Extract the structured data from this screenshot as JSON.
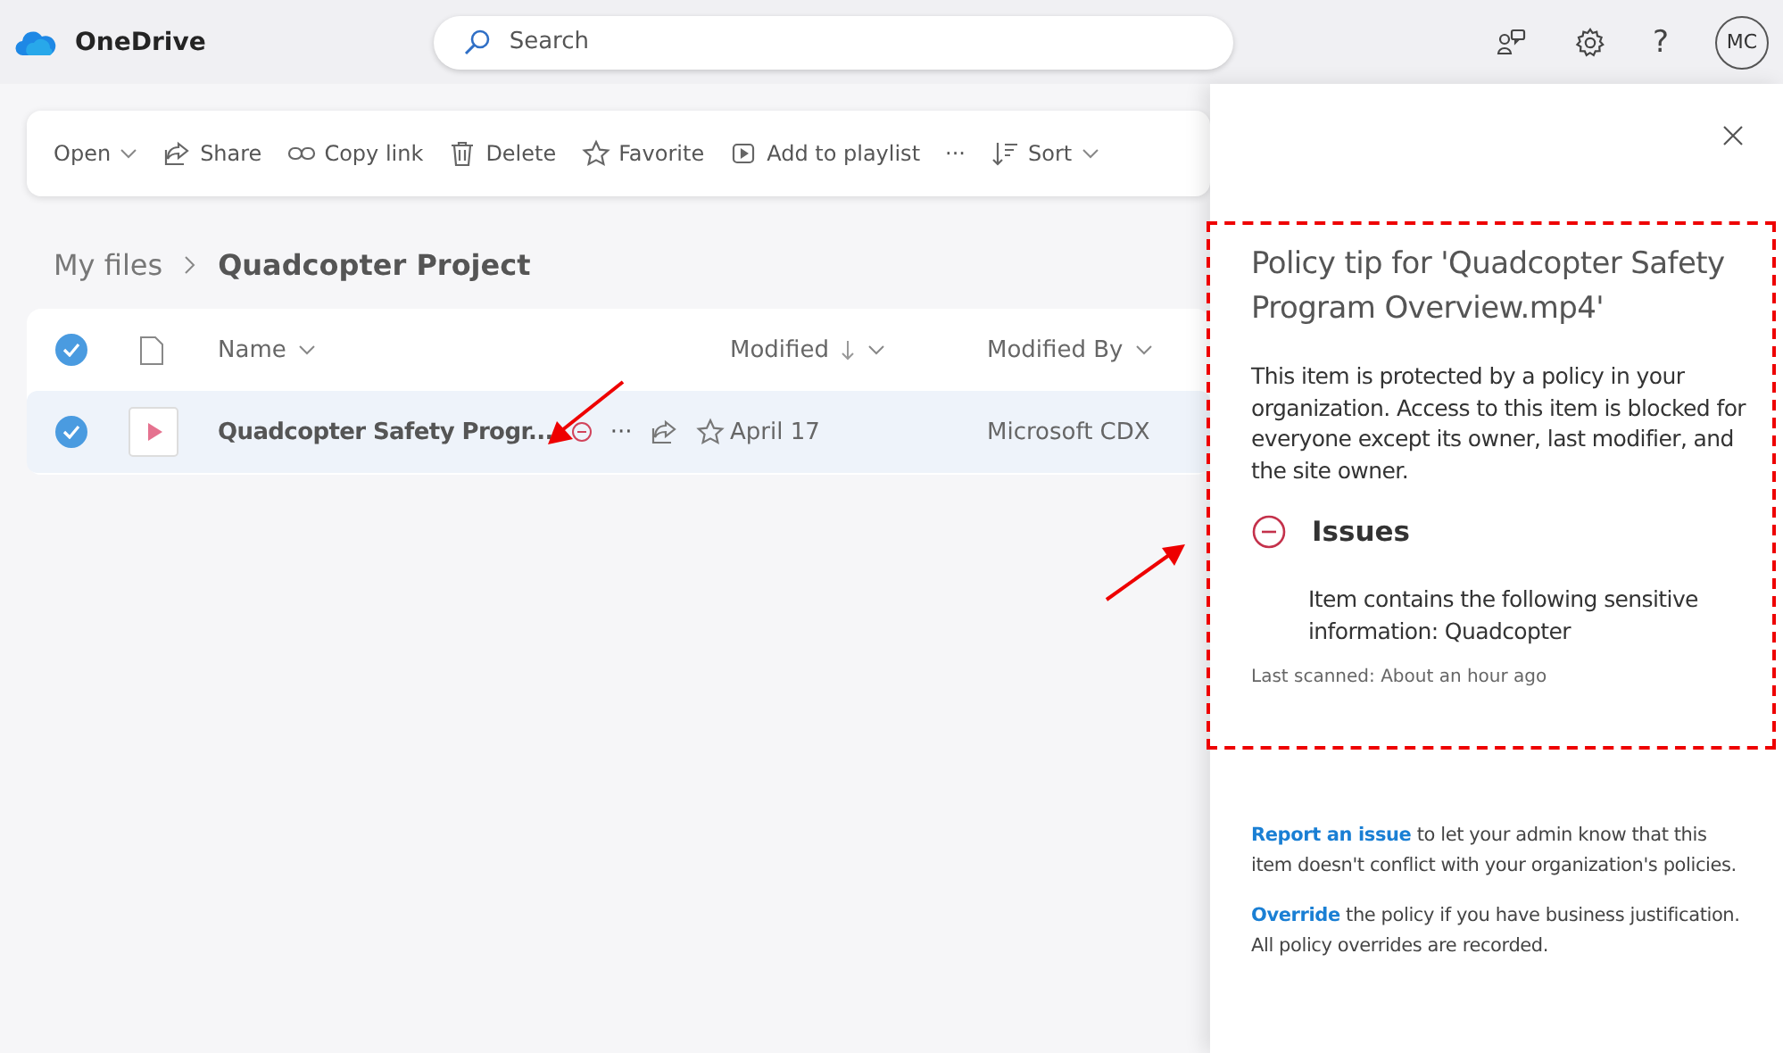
{
  "app": {
    "name": "OneDrive"
  },
  "search": {
    "placeholder": "Search"
  },
  "header": {
    "help": "?",
    "avatar": "MC"
  },
  "toolbar": [
    {
      "label": "Open",
      "kind": "dropdown"
    },
    {
      "label": "Share",
      "kind": "share"
    },
    {
      "label": "Copy link",
      "kind": "link"
    },
    {
      "label": "Delete",
      "kind": "delete"
    },
    {
      "label": "Favorite",
      "kind": "star"
    },
    {
      "label": "Add to playlist",
      "kind": "playlist"
    },
    {
      "label": "···",
      "kind": "more"
    },
    {
      "label": "Sort",
      "kind": "sort"
    }
  ],
  "breadcrumb": [
    "My files",
    "Quadcopter Project"
  ],
  "table": {
    "all_selected": true,
    "columns": [
      {
        "label": "Name",
        "sorted": false
      },
      {
        "label": "Modified",
        "sorted": true
      },
      {
        "label": "Modified By",
        "sorted": false
      }
    ],
    "rows": [
      {
        "selected": true,
        "name": "Quadcopter Safety Progr...",
        "blocked": true,
        "more": "···",
        "modified": "April 17",
        "modified_by": "Microsoft CDX"
      }
    ]
  },
  "panel": {
    "title": "Policy tip for 'Quadcopter Safety Program Overview.mp4'",
    "body": "This item is protected by a policy in your organization. Access to this item is blocked for everyone except its owner, last modifier, and the site owner.",
    "issues_heading": "Issues",
    "issue": "Item contains the following sensitive information: Quadcopter",
    "last_scanned": "Last scanned: About an hour ago",
    "actions": [
      {
        "link": "Report an issue",
        "text": " to let your admin know that this item doesn't conflict with your organization's policies."
      },
      {
        "link": "Override",
        "text": " the policy if you have business justification. All policy overrides are recorded."
      }
    ]
  }
}
